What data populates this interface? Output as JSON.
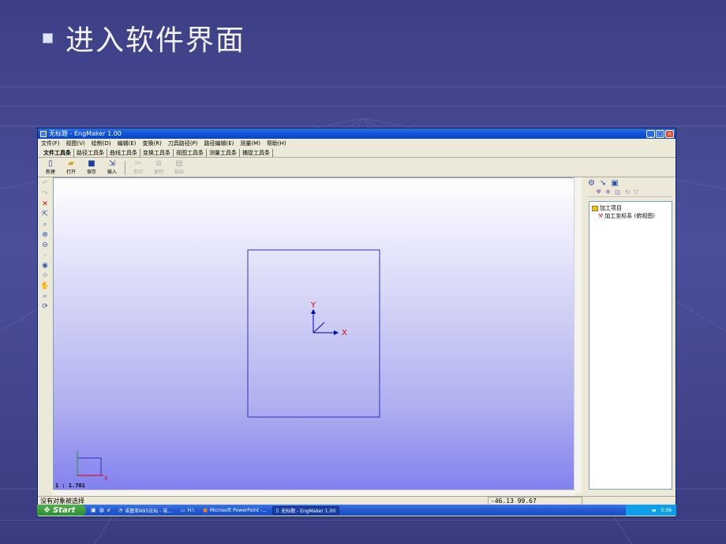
{
  "slide": {
    "title": "进入软件界面"
  },
  "window": {
    "title": "无标题 - EngMaker 1.00",
    "buttons": {
      "minimize": "_",
      "maximize": "□",
      "close": "×"
    }
  },
  "menu": [
    "文件(F)",
    "视图(V)",
    "绘制(D)",
    "编辑(E)",
    "变换(R)",
    "刀具路径(P)",
    "路径编辑(E)",
    "测量(M)",
    "帮助(H)"
  ],
  "tabs": [
    "文件工具条",
    "路径工具条",
    "曲线工具条",
    "变换工具条",
    "视图工具条",
    "测量工具条",
    "捕捉工具条"
  ],
  "toolbar": [
    {
      "label": "新建",
      "icon": "new-file-icon",
      "enabled": true
    },
    {
      "label": "打开",
      "icon": "open-folder-icon",
      "enabled": true
    },
    {
      "label": "保存",
      "icon": "save-icon",
      "enabled": true
    },
    {
      "label": "输入",
      "icon": "import-icon",
      "enabled": true
    },
    {
      "label": "剪切",
      "icon": "cut-icon",
      "enabled": false
    },
    {
      "label": "复制",
      "icon": "copy-icon",
      "enabled": false
    },
    {
      "label": "粘贴",
      "icon": "paste-icon",
      "enabled": false
    }
  ],
  "canvas": {
    "scale": "1 : 1.701",
    "axis_x": "X",
    "axis_y": "Y",
    "colors": {
      "rect": "#3030b0",
      "axis_x": "#e00000",
      "axis_y": "#0000c0",
      "bg_top": "#ffffff",
      "bg_bottom": "#8080f0"
    }
  },
  "tree": {
    "root": "加工项目",
    "child": "加工坐标系 (俯视图)"
  },
  "status": {
    "message": "没有对象被选择",
    "coords": "-46.13  99.67"
  },
  "taskbar": {
    "start": "Start",
    "tasks": [
      {
        "label": "诺基亚N95论坛 - 诺...",
        "active": false
      },
      {
        "label": "H:\\",
        "active": false
      },
      {
        "label": "Microsoft PowerPoint -...",
        "active": false
      },
      {
        "label": "无标题 - EngMaker 1.00",
        "active": true
      }
    ],
    "time": "0:56"
  }
}
